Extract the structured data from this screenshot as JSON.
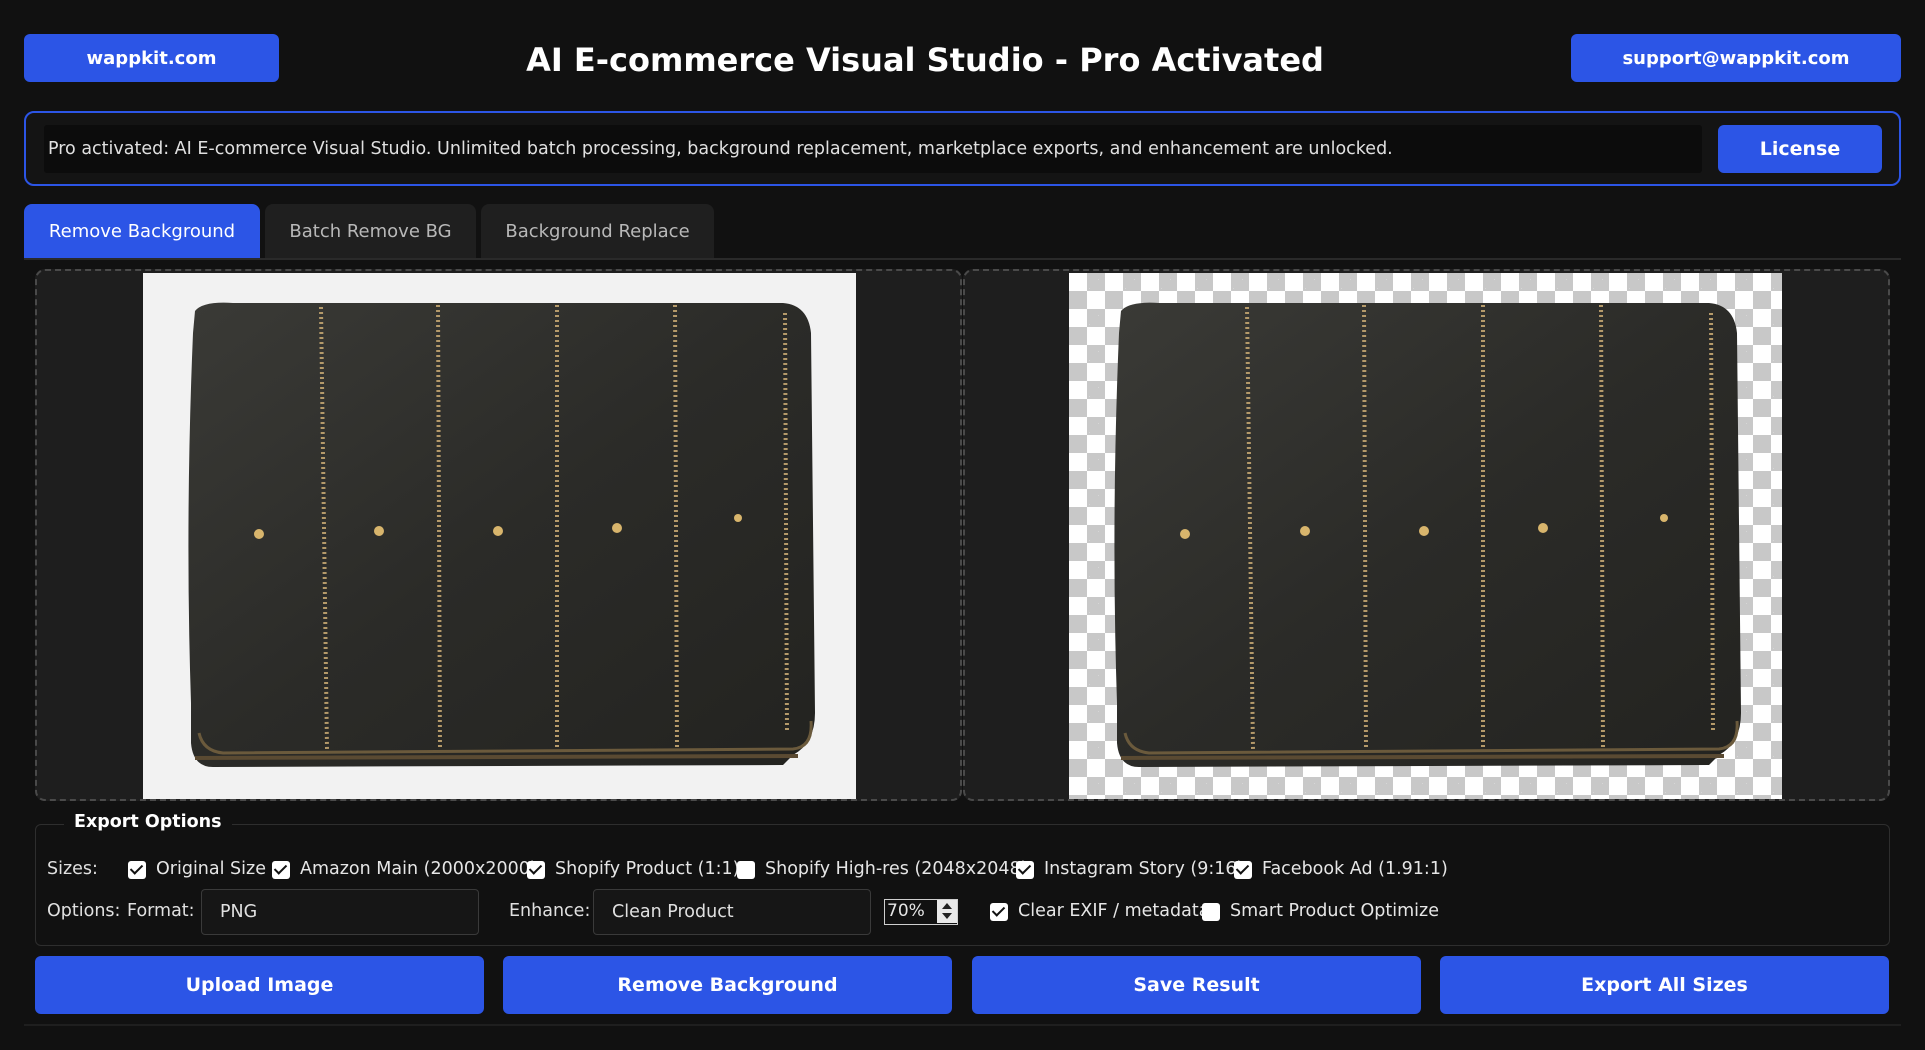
{
  "header": {
    "left_link": "wappkit.com",
    "title": "AI E-commerce Visual Studio - Pro Activated",
    "right_link": "support@wappkit.com"
  },
  "banner": {
    "message": "Pro activated: AI E-commerce Visual Studio. Unlimited batch processing, background replacement, marketplace exports, and enhancement are unlocked.",
    "license_label": "License"
  },
  "tabs": [
    {
      "label": "Remove Background",
      "active": true
    },
    {
      "label": "Batch Remove BG",
      "active": false
    },
    {
      "label": "Background Replace",
      "active": false
    }
  ],
  "export": {
    "legend": "Export Options",
    "sizes_label": "Sizes:",
    "sizes": [
      {
        "label": "Original Size",
        "checked": true
      },
      {
        "label": "Amazon Main (2000x2000)",
        "checked": true
      },
      {
        "label": "Shopify Product (1:1)",
        "checked": true
      },
      {
        "label": "Shopify High-res (2048x2048)",
        "checked": false
      },
      {
        "label": "Instagram Story (9:16)",
        "checked": true
      },
      {
        "label": "Facebook Ad (1.91:1)",
        "checked": true
      }
    ],
    "options_label": "Options:",
    "format_label": "Format:",
    "format_value": "PNG",
    "enhance_label": "Enhance:",
    "enhance_value": "Clean Product",
    "strength_value": "70%",
    "clear_exif": {
      "label": "Clear EXIF / metadata",
      "checked": true
    },
    "smart_optimize": {
      "label": "Smart Product Optimize",
      "checked": false
    }
  },
  "actions": {
    "upload": "Upload Image",
    "remove": "Remove Background",
    "save": "Save Result",
    "export_all": "Export All Sizes"
  },
  "colors": {
    "accent": "#2c55e6",
    "background": "#111111"
  }
}
